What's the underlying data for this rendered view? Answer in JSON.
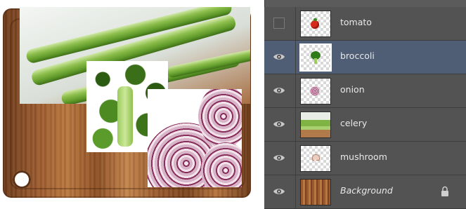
{
  "layers_panel": {
    "layers": [
      {
        "name": "tomato",
        "visible": false,
        "selected": false,
        "italic": false,
        "locked": false,
        "thumb": "tomato"
      },
      {
        "name": "broccoli",
        "visible": true,
        "selected": true,
        "italic": false,
        "locked": false,
        "thumb": "broccoli"
      },
      {
        "name": "onion",
        "visible": true,
        "selected": false,
        "italic": false,
        "locked": false,
        "thumb": "onion"
      },
      {
        "name": "celery",
        "visible": true,
        "selected": false,
        "italic": false,
        "locked": false,
        "thumb": "celery"
      },
      {
        "name": "mushroom",
        "visible": true,
        "selected": false,
        "italic": false,
        "locked": false,
        "thumb": "mushroom"
      },
      {
        "name": "Background",
        "visible": true,
        "selected": false,
        "italic": true,
        "locked": true,
        "thumb": "wood"
      }
    ]
  },
  "colors": {
    "panel_bg": "#535353",
    "selected_row": "#4f5e74",
    "layer_text": "#e8e8e8"
  }
}
